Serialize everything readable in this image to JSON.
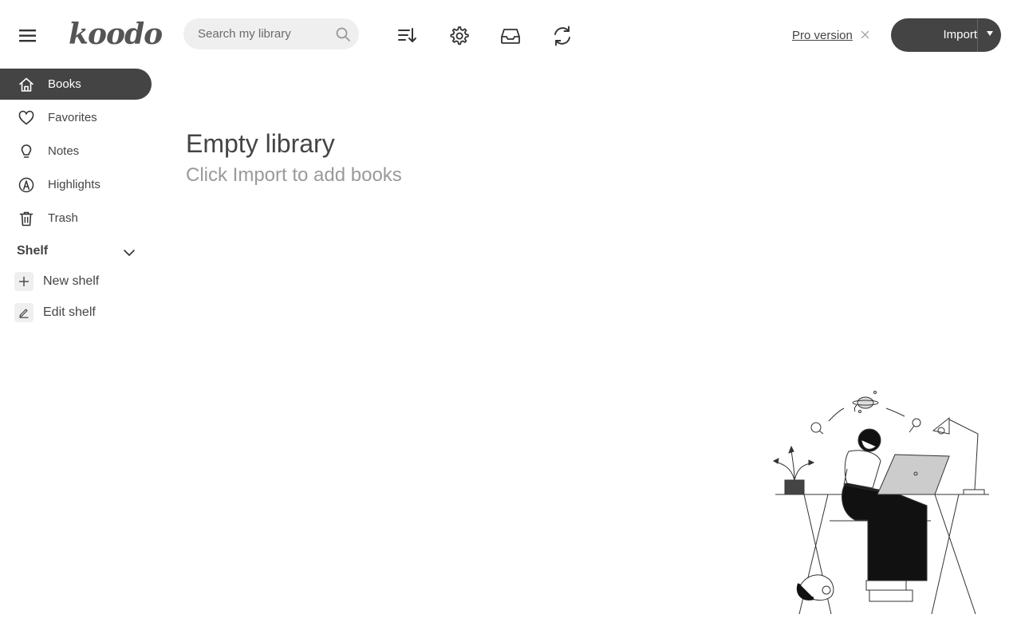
{
  "header": {
    "logo": "koodo",
    "search": {
      "placeholder": "Search my library",
      "value": ""
    },
    "tools": [
      {
        "icon": "sort-icon"
      },
      {
        "icon": "settings-gear-icon"
      },
      {
        "icon": "inbox-icon"
      },
      {
        "icon": "sync-refresh-icon"
      }
    ],
    "pro_label": "Pro version",
    "import_label": "Import"
  },
  "sidebar": {
    "items": [
      {
        "label": "Books",
        "icon": "home-icon",
        "active": true
      },
      {
        "label": "Favorites",
        "icon": "heart-icon",
        "active": false
      },
      {
        "label": "Notes",
        "icon": "lightbulb-icon",
        "active": false
      },
      {
        "label": "Highlights",
        "icon": "highlighter-icon",
        "active": false
      },
      {
        "label": "Trash",
        "icon": "trash-icon",
        "active": false
      }
    ],
    "shelf": {
      "title": "Shelf",
      "new_label": "New shelf",
      "edit_label": "Edit shelf"
    }
  },
  "main": {
    "empty_title": "Empty library",
    "empty_subtitle": "Click Import to add books"
  },
  "colors": {
    "accent": "#444444",
    "search_bg": "#efefef",
    "muted_text": "#9a9a9a"
  }
}
